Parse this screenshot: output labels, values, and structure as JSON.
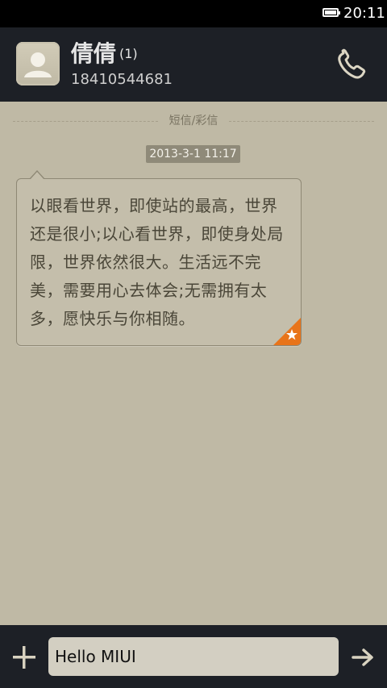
{
  "status_bar": {
    "time": "20:11",
    "icons": [
      "battery-icon"
    ]
  },
  "header": {
    "contact_name": "倩倩",
    "message_count": "(1)",
    "phone_number": "18410544681",
    "icons": [
      "avatar-placeholder-icon",
      "phone-call-icon"
    ]
  },
  "thread": {
    "divider_label": "短信/彩信",
    "messages": [
      {
        "timestamp": "2013-3-1 11:17",
        "text": "以眼看世界，即使站的最高，世界还是很小;以心看世界，即使身处局限，世界依然很大。生活远不完美，需要用心去体会;无需拥有太多，愿快乐与你相随。",
        "starred": true
      }
    ]
  },
  "composer": {
    "input_value": "Hello MIUI",
    "icons": [
      "plus-icon",
      "arrow-right-icon"
    ]
  },
  "colors": {
    "background": "#bfb9a5",
    "bar": "#1d2026",
    "star_badge": "#e8741a"
  }
}
